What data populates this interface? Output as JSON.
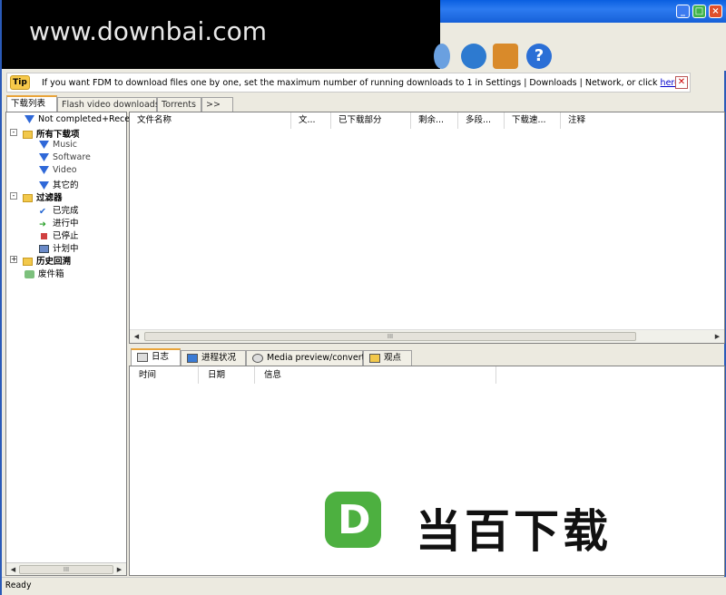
{
  "watermark": "www.downbai.com",
  "tip": {
    "badge": "Tip",
    "text": "If you want FDM to download files one by one, set the maximum number of running downloads to 1 in Settings | Downloads | Network, or click ",
    "link": "here",
    "after": ".",
    "close": "✕"
  },
  "top_tabs": [
    "下载列表",
    "Flash video downloads",
    "Torrents",
    ">>"
  ],
  "tree": {
    "root": "Not completed+Recent",
    "all": "所有下载项",
    "music": "Music",
    "software": "Software",
    "video": "Video",
    "other": "其它的",
    "filter": "过滤器",
    "done": "已完成",
    "running": "进行中",
    "stopped": "已停止",
    "scheduled": "计划中",
    "history": "历史回溯",
    "trash": "废件箱"
  },
  "list_columns": [
    "文件名称",
    "文...",
    "已下载部分",
    "剩余...",
    "多段...",
    "下载速...",
    "注释"
  ],
  "bottom_tabs": [
    "日志",
    "进程状况",
    "Media preview/convert",
    "观点"
  ],
  "log_columns": [
    "时间",
    "日期",
    "信息"
  ],
  "status": "Ready",
  "logo": {
    "letter": "D",
    "text": "当百下载",
    "color": "#4db040"
  },
  "scroll_thumb": "III",
  "colors": {
    "titlebar": "#1660d8",
    "accent_tab": "#e9a43a"
  }
}
